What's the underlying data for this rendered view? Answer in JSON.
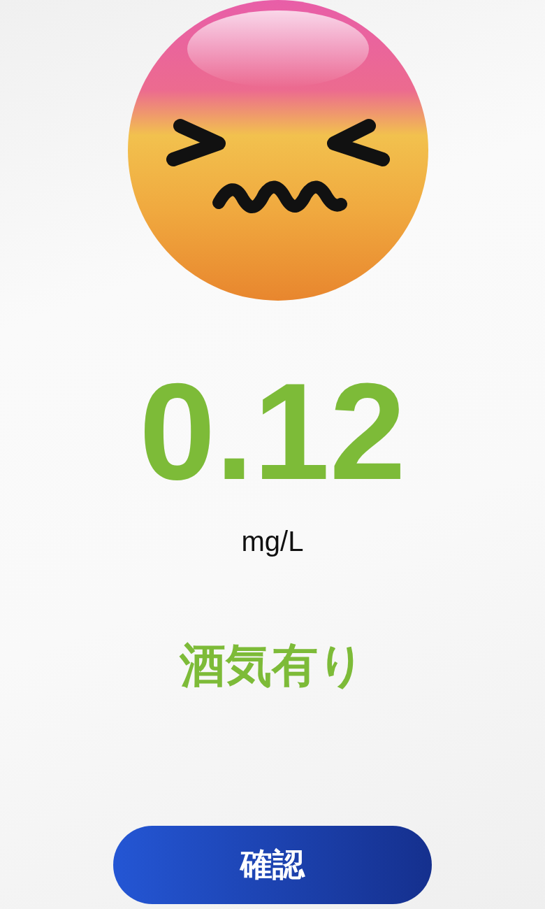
{
  "reading": {
    "value": "0.12",
    "unit": "mg/L"
  },
  "status": "酒気有り",
  "button": {
    "label": "確認"
  }
}
